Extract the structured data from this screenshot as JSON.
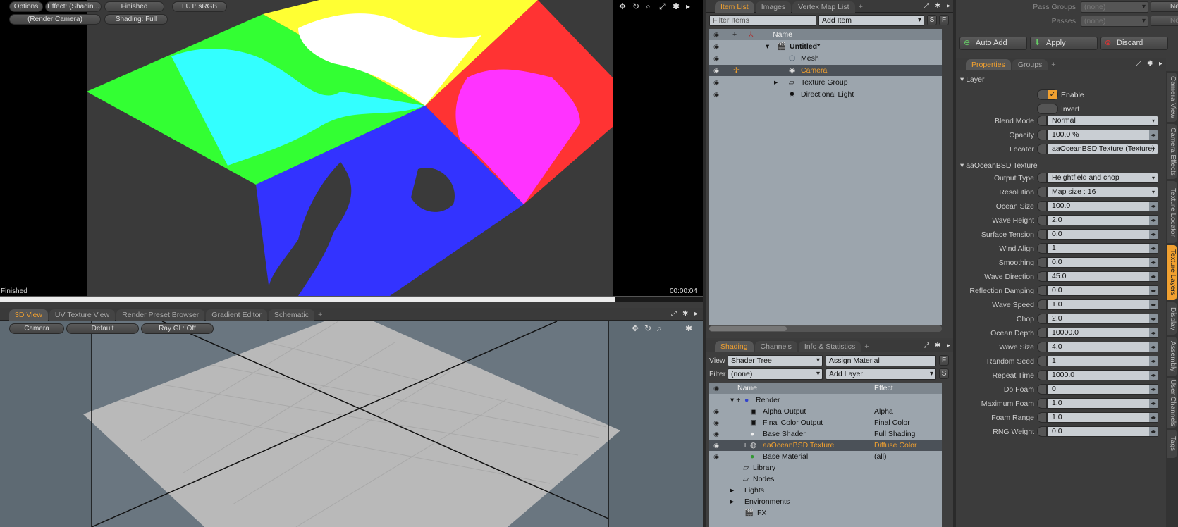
{
  "render_view": {
    "options": "Options",
    "effect": "Effect: (Shadin...",
    "status_btn": "Finished",
    "lut": "LUT: sRGB",
    "camera": "(Render Camera)",
    "shading": "Shading: Full",
    "status_text": "Finished",
    "time": "00:00:04",
    "progress": 1.0
  },
  "viewport_tabs": {
    "items": [
      "3D View",
      "UV Texture View",
      "Render Preset Browser",
      "Gradient Editor",
      "Schematic"
    ],
    "active": "3D View",
    "plus": "+"
  },
  "viewport": {
    "camera": "Camera",
    "style": "Default",
    "raygl": "Ray GL: Off"
  },
  "item_tabs": {
    "items": [
      "Item List",
      "Images",
      "Vertex Map List"
    ],
    "plus": "+"
  },
  "item_list": {
    "filter_placeholder": "Filter Items",
    "add_item": "Add Item",
    "s_btn": "S",
    "f_btn": "F",
    "col_name": "Name",
    "rows": [
      {
        "label": "Untitled*",
        "icon": "scene-icon"
      },
      {
        "label": "Mesh",
        "icon": "mesh-icon"
      },
      {
        "label": "Camera",
        "icon": "camera-icon"
      },
      {
        "label": "Texture Group",
        "icon": "folder-icon"
      },
      {
        "label": "Directional Light",
        "icon": "light-icon"
      }
    ]
  },
  "shading_tabs": {
    "items": [
      "Shading",
      "Channels",
      "Info & Statistics"
    ],
    "plus": "+"
  },
  "shading": {
    "view_label": "View",
    "view_value": "Shader Tree",
    "assign": "Assign Material",
    "filter_label": "Filter",
    "filter_value": "(none)",
    "add_layer": "Add Layer",
    "f_btn": "F",
    "s_btn": "S",
    "col_name": "Name",
    "col_effect": "Effect",
    "rows": [
      {
        "name": "Render",
        "effect": ""
      },
      {
        "name": "Alpha Output",
        "effect": "Alpha"
      },
      {
        "name": "Final Color Output",
        "effect": "Final Color"
      },
      {
        "name": "Base Shader",
        "effect": "Full Shading"
      },
      {
        "name": "aaOceanBSD Texture",
        "effect": "Diffuse Color"
      },
      {
        "name": "Base Material",
        "effect": "(all)"
      },
      {
        "name": "Library",
        "effect": ""
      },
      {
        "name": "Nodes",
        "effect": ""
      },
      {
        "name": "Lights",
        "effect": ""
      },
      {
        "name": "Environments",
        "effect": ""
      },
      {
        "name": "FX",
        "effect": ""
      }
    ]
  },
  "top_right": {
    "pass_groups": "Pass Groups",
    "passes": "Passes",
    "none": "(none)",
    "new": "New",
    "auto_add": "Auto Add",
    "apply": "Apply",
    "discard": "Discard"
  },
  "props_tabs": {
    "items": [
      "Properties",
      "Groups"
    ],
    "plus": "+"
  },
  "props": {
    "layer_section": "Layer",
    "enable": "Enable",
    "invert": "Invert",
    "texture_section": "aaOceanBSD Texture",
    "rows": [
      {
        "label": "Blend Mode",
        "value": "Normal",
        "kind": "drop"
      },
      {
        "label": "Opacity",
        "value": "100.0 %",
        "kind": "num"
      },
      {
        "label": "Locator",
        "value": "aaOceanBSD Texture (Texture)",
        "kind": "drop"
      },
      {
        "label": "Output Type",
        "value": "Heightfield and chop",
        "kind": "drop"
      },
      {
        "label": "Resolution",
        "value": "Map size : 16",
        "kind": "drop"
      },
      {
        "label": "Ocean Size",
        "value": "100.0",
        "kind": "num"
      },
      {
        "label": "Wave Height",
        "value": "2.0",
        "kind": "num"
      },
      {
        "label": "Surface Tension",
        "value": "0.0",
        "kind": "num"
      },
      {
        "label": "Wind Align",
        "value": "1",
        "kind": "num"
      },
      {
        "label": "Smoothing",
        "value": "0.0",
        "kind": "num"
      },
      {
        "label": "Wave Direction",
        "value": "45.0",
        "kind": "num"
      },
      {
        "label": "Reflection Damping",
        "value": "0.0",
        "kind": "num"
      },
      {
        "label": "Wave Speed",
        "value": "1.0",
        "kind": "num"
      },
      {
        "label": "Chop",
        "value": "2.0",
        "kind": "num"
      },
      {
        "label": "Ocean Depth",
        "value": "10000.0",
        "kind": "num"
      },
      {
        "label": "Wave Size",
        "value": "4.0",
        "kind": "num"
      },
      {
        "label": "Random Seed",
        "value": "1",
        "kind": "num"
      },
      {
        "label": "Repeat Time",
        "value": "1000.0",
        "kind": "num"
      },
      {
        "label": "Do Foam",
        "value": "0",
        "kind": "num"
      },
      {
        "label": "Maximum Foam",
        "value": "1.0",
        "kind": "num"
      },
      {
        "label": "Foam Range",
        "value": "1.0",
        "kind": "num"
      },
      {
        "label": "RNG Weight",
        "value": "0.0",
        "kind": "num"
      }
    ]
  },
  "side_tabs": [
    "Camera View",
    "Camera Effects",
    "Texture Locator",
    "Texture Layers",
    "Display",
    "Assembly",
    "User Channels",
    "Tags"
  ],
  "side_tab_active": "Texture Layers"
}
